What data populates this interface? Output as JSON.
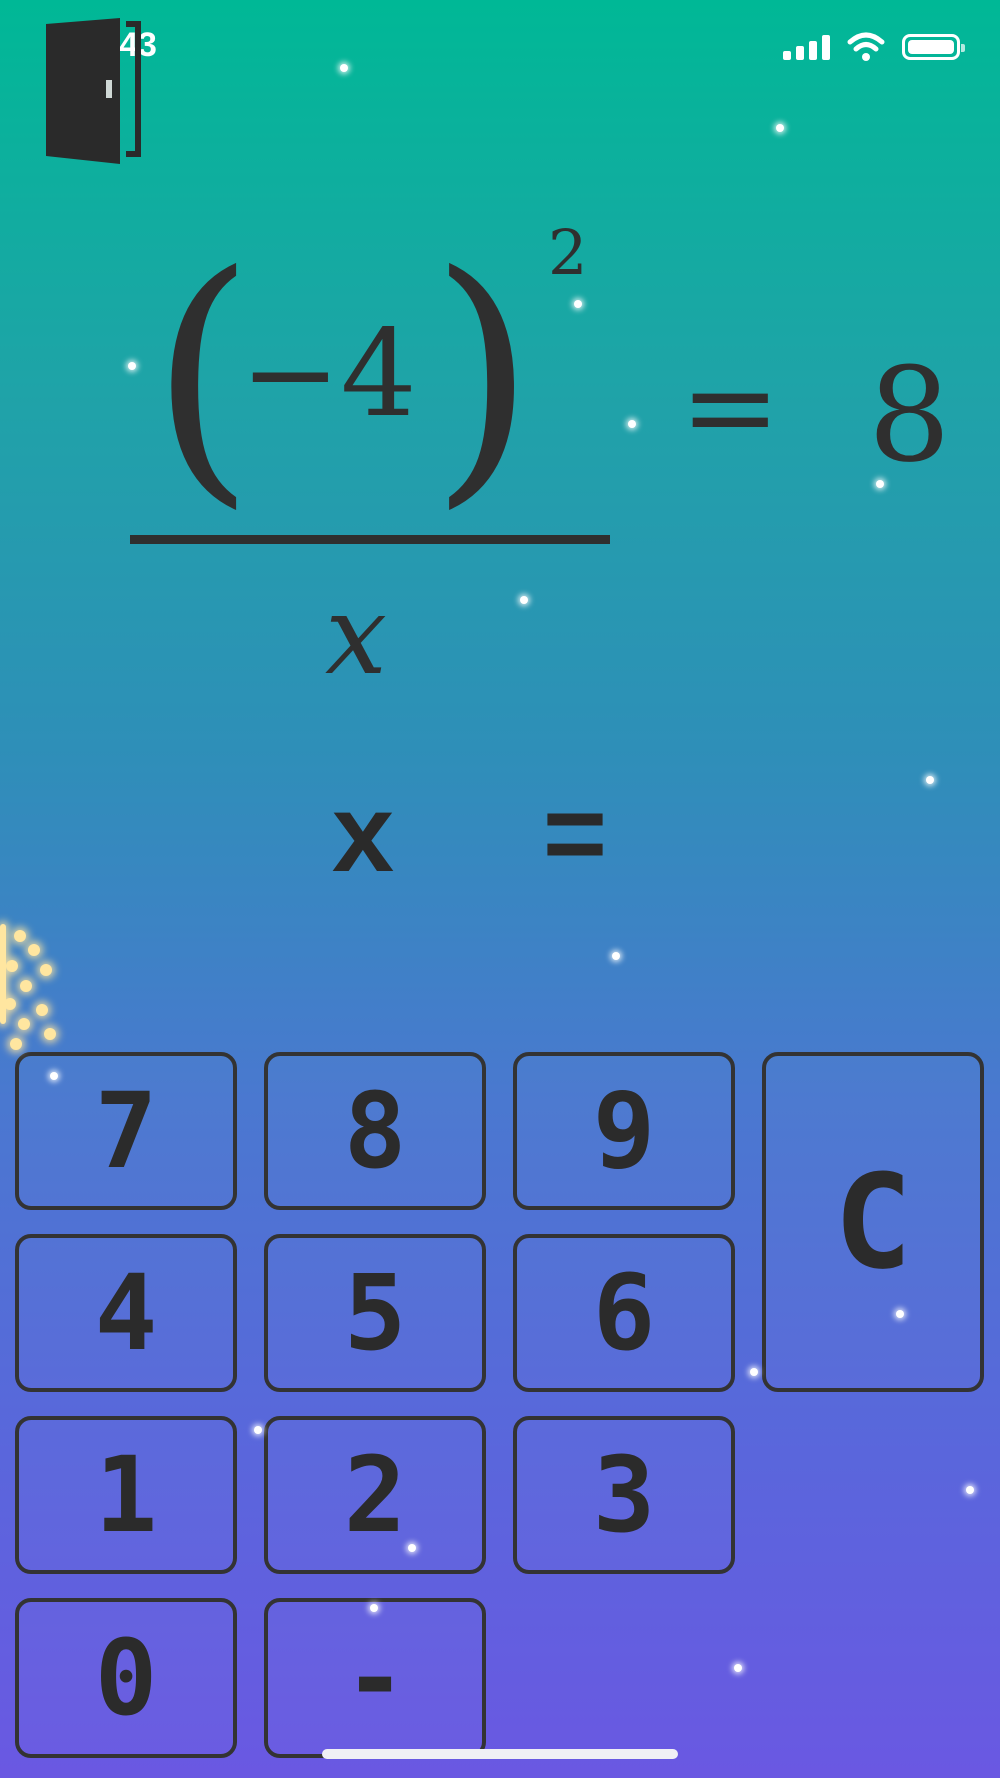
{
  "status_bar": {
    "time": "12:43"
  },
  "equation": {
    "numerator": "−4",
    "exponent": "2",
    "denominator": "x",
    "equals_sign": "=",
    "result": "8"
  },
  "answer": {
    "text": "x =",
    "value": ""
  },
  "keypad": {
    "keys": [
      "7",
      "8",
      "9",
      "4",
      "5",
      "6",
      "1",
      "2",
      "3",
      "0",
      "-"
    ],
    "clear_label": "C"
  },
  "colors": {
    "background_top": "#00b896",
    "background_bottom": "#6a58e2",
    "ink": "#2e2e2e"
  }
}
